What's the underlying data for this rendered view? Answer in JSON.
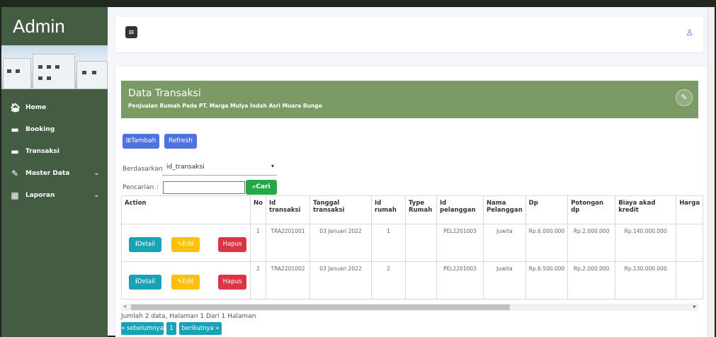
{
  "sidebar": {
    "brand": "Admin",
    "items": [
      {
        "label": "Home",
        "icon": "home-icon",
        "glyph": "🏠︎"
      },
      {
        "label": "Booking",
        "icon": "database-icon",
        "glyph": "▬"
      },
      {
        "label": "Transaksi",
        "icon": "database-icon",
        "glyph": "▬"
      },
      {
        "label": "Master Data",
        "icon": "edit-icon",
        "glyph": "✎"
      },
      {
        "label": "Laporan",
        "icon": "calendar-icon",
        "glyph": "▦"
      }
    ]
  },
  "header": {
    "title": "Data Transaksi",
    "subtitle": "Penjualan Rumah Pada PT. Marga Mulya Indah Asri Muara Bungo"
  },
  "toolbar": {
    "tambah_label": "Tambah",
    "refresh_label": "Refresh"
  },
  "filter": {
    "berdasarkan_label": "Berdasarkan:",
    "berdasarkan_value": "id_transaksi",
    "pencarian_label": "Pencarian",
    "pencarian_sep": ":",
    "search_value": "",
    "cari_label": "Cari"
  },
  "table": {
    "columns": [
      "Action",
      "No",
      "Id transaksi",
      "Tanggal transaksi",
      "Id rumah",
      "Type Rumah",
      "Id pelanggan",
      "Nama Pelanggan",
      "Dp",
      "Potongan dp",
      "Biaya akad kredit",
      "Harga"
    ],
    "action_labels": {
      "detail": "Detail",
      "edit": "Edit",
      "hapus": "Hapus"
    },
    "rows": [
      [
        "1",
        "TRA2201001",
        "03 Januari 2022",
        "1",
        "",
        "PEL2201003",
        "Juwita",
        "Rp.6.000.000",
        "Rp.2.000.000",
        "Rp.140.000.000",
        ""
      ],
      [
        "2",
        "TRA2201002",
        "03 Januari 2022",
        "2",
        "",
        "PEL2201003",
        "Juwita",
        "Rp.6.500.000",
        "Rp.2.000.000",
        "Rp.130.000.000",
        ""
      ]
    ]
  },
  "footer": {
    "summary": "Jumlah 2 data, Halaman 1 Dari 1 Halaman",
    "prev_label": "« sebelumnya",
    "page_label": "1",
    "next_label": "berikutnya »"
  },
  "colors": {
    "sidebar": "#435c42",
    "header": "#7b9a66",
    "primary": "#4e73df",
    "success": "#28a745",
    "info": "#17a2b8",
    "warning": "#ffc107",
    "danger": "#dc3545"
  }
}
